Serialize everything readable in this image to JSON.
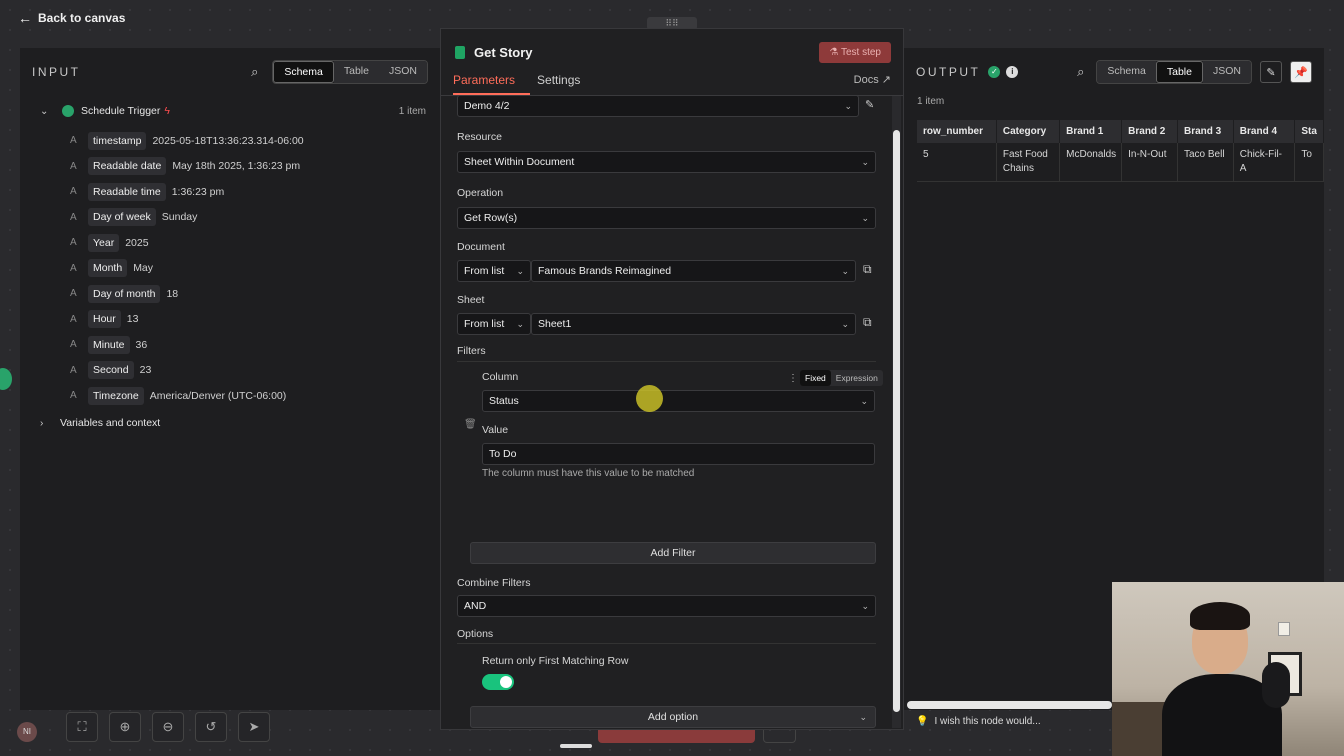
{
  "nav": {
    "back_label": "Back to canvas"
  },
  "input_panel": {
    "title": "INPUT",
    "view_tabs": [
      "Schema",
      "Table",
      "JSON"
    ],
    "active_view": "Schema",
    "trigger": {
      "name": "Schedule Trigger",
      "count": "1 item"
    },
    "fields": [
      {
        "type": "A",
        "name": "timestamp",
        "value": "2025-05-18T13:36:23.314-06:00"
      },
      {
        "type": "A",
        "name": "Readable date",
        "value": "May 18th 2025, 1:36:23 pm"
      },
      {
        "type": "A",
        "name": "Readable time",
        "value": "1:36:23 pm"
      },
      {
        "type": "A",
        "name": "Day of week",
        "value": "Sunday"
      },
      {
        "type": "A",
        "name": "Year",
        "value": "2025"
      },
      {
        "type": "A",
        "name": "Month",
        "value": "May"
      },
      {
        "type": "A",
        "name": "Day of month",
        "value": "18"
      },
      {
        "type": "A",
        "name": "Hour",
        "value": "13"
      },
      {
        "type": "A",
        "name": "Minute",
        "value": "36"
      },
      {
        "type": "A",
        "name": "Second",
        "value": "23"
      },
      {
        "type": "A",
        "name": "Timezone",
        "value": "America/Denver (UTC-06:00)"
      }
    ],
    "variables_label": "Variables and context"
  },
  "node_modal": {
    "title": "Get Story",
    "test_button": "Test step",
    "tabs": [
      "Parameters",
      "Settings"
    ],
    "active_tab": "Parameters",
    "docs_label": "Docs",
    "credential_value": "Demo 4/2",
    "resource": {
      "label": "Resource",
      "value": "Sheet Within Document"
    },
    "operation": {
      "label": "Operation",
      "value": "Get Row(s)"
    },
    "document": {
      "label": "Document",
      "mode": "From list",
      "value": "Famous Brands Reimagined"
    },
    "sheet": {
      "label": "Sheet",
      "mode": "From list",
      "value": "Sheet1"
    },
    "filters": {
      "label": "Filters",
      "column_label": "Column",
      "mode_fixed": "Fixed",
      "mode_expression": "Expression",
      "column_value": "Status",
      "value_label": "Value",
      "value_value": "To Do",
      "hint": "The column must have this value to be matched",
      "add_filter": "Add Filter"
    },
    "combine_filters": {
      "label": "Combine Filters",
      "value": "AND"
    },
    "options": {
      "label": "Options",
      "return_first_label": "Return only First Matching Row",
      "return_first_on": true,
      "add_option": "Add option"
    }
  },
  "output_panel": {
    "title": "OUTPUT",
    "view_tabs": [
      "Schema",
      "Table",
      "JSON"
    ],
    "active_view": "Table",
    "count": "1 item",
    "columns": [
      "row_number",
      "Category",
      "Brand 1",
      "Brand 2",
      "Brand 3",
      "Brand 4",
      "Sta"
    ],
    "rows": [
      [
        "5",
        "Fast Food Chains",
        "McDonalds",
        "In-N-Out",
        "Taco Bell",
        "Chick-Fil-A",
        "To"
      ]
    ],
    "wish_text": "I wish this node would..."
  },
  "bottom_toolbar": {
    "avatar_initials": "NI",
    "tools": [
      "fit-view-icon",
      "zoom-in-icon",
      "zoom-out-icon",
      "undo-icon",
      "cursor-icon"
    ]
  },
  "colors": {
    "accent": "#ff6d5a",
    "success": "#29a36a",
    "toggle_on": "#19c37d"
  }
}
